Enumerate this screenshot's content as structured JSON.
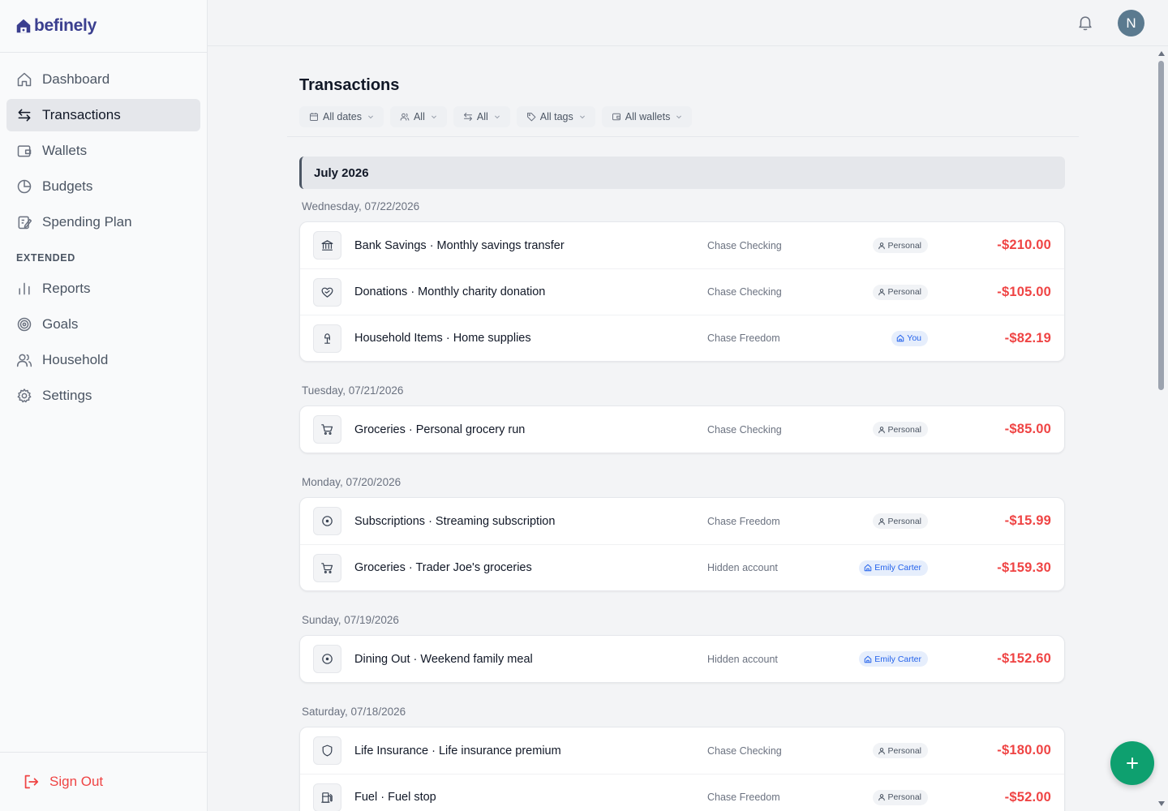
{
  "app": {
    "logo_text": "befinely"
  },
  "sidebar": {
    "items": [
      {
        "label": "Dashboard",
        "icon": "home-icon"
      },
      {
        "label": "Transactions",
        "icon": "arrows-swap-icon",
        "active": true
      },
      {
        "label": "Wallets",
        "icon": "wallet-icon"
      },
      {
        "label": "Budgets",
        "icon": "pie-chart-icon"
      },
      {
        "label": "Spending Plan",
        "icon": "edit-plan-icon"
      }
    ],
    "section_label": "EXTENDED",
    "extended_items": [
      {
        "label": "Reports",
        "icon": "bar-chart-icon"
      },
      {
        "label": "Goals",
        "icon": "target-icon"
      },
      {
        "label": "Household",
        "icon": "users-icon"
      },
      {
        "label": "Settings",
        "icon": "gear-icon"
      }
    ],
    "sign_out": "Sign Out"
  },
  "topbar": {
    "avatar_initial": "N"
  },
  "page": {
    "title": "Transactions",
    "filters": {
      "dates": "All dates",
      "people": "All",
      "types": "All",
      "tags": "All tags",
      "wallets": "All wallets"
    },
    "month": "July 2026"
  },
  "days": [
    {
      "label": "Wednesday, 07/22/2026",
      "transactions": [
        {
          "title": "Bank Savings · Monthly savings transfer",
          "account": "Chase Checking",
          "tag": "Personal",
          "amount": "-$210.00",
          "icon": "bank-icon"
        },
        {
          "title": "Donations · Monthly charity donation",
          "account": "Chase Checking",
          "tag": "Personal",
          "amount": "-$105.00",
          "icon": "heart-hand-icon"
        },
        {
          "title": "Household Items · Home supplies",
          "account": "Chase Freedom",
          "tag": "You",
          "amount": "-$82.19",
          "icon": "lamp-icon"
        }
      ]
    },
    {
      "label": "Tuesday, 07/21/2026",
      "transactions": [
        {
          "title": "Groceries · Personal grocery run",
          "account": "Chase Checking",
          "tag": "Personal",
          "amount": "-$85.00",
          "icon": "cart-icon"
        }
      ]
    },
    {
      "label": "Monday, 07/20/2026",
      "transactions": [
        {
          "title": "Subscriptions · Streaming subscription",
          "account": "Chase Freedom",
          "tag": "Personal",
          "amount": "-$15.99",
          "icon": "circle-dot-icon"
        },
        {
          "title": "Groceries · Trader Joe's groceries",
          "account": "Hidden account",
          "tag": "Emily Carter",
          "amount": "-$159.30",
          "icon": "cart-icon"
        }
      ]
    },
    {
      "label": "Sunday, 07/19/2026",
      "transactions": [
        {
          "title": "Dining Out · Weekend family meal",
          "account": "Hidden account",
          "tag": "Emily Carter",
          "amount": "-$152.60",
          "icon": "circle-dot-icon"
        }
      ]
    },
    {
      "label": "Saturday, 07/18/2026",
      "transactions": [
        {
          "title": "Life Insurance · Life insurance premium",
          "account": "Chase Checking",
          "tag": "Personal",
          "amount": "-$180.00",
          "icon": "shield-icon"
        },
        {
          "title": "Fuel · Fuel stop",
          "account": "Chase Freedom",
          "tag": "Personal",
          "amount": "-$52.00",
          "icon": "fuel-icon"
        }
      ]
    }
  ],
  "colors": {
    "accent_green": "#0ea06f",
    "negative_red": "#ef4444",
    "logo_navy": "#3b3f8f"
  }
}
